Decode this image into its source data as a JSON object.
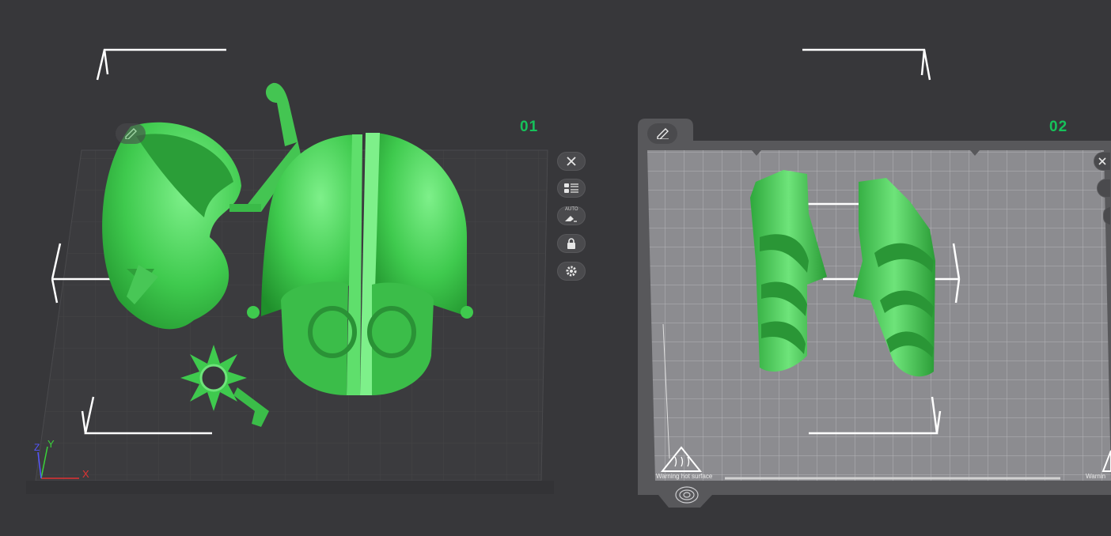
{
  "plates": [
    {
      "label": "01",
      "buttons": [
        "close-icon",
        "list-icon",
        "auto-orient-icon",
        "lock-icon",
        "gear-icon"
      ]
    },
    {
      "label": "02",
      "warning": "Warning hot surface",
      "warning_right": "Warnin"
    }
  ],
  "auto_badge": "AUTO",
  "axes": {
    "x": "X",
    "y": "Y",
    "z": "Z"
  },
  "colors": {
    "model": "#3fca4e",
    "model_light": "#74e880",
    "model_dark": "#1f8f2b",
    "label": "#16c25a",
    "background": "#37373a"
  }
}
